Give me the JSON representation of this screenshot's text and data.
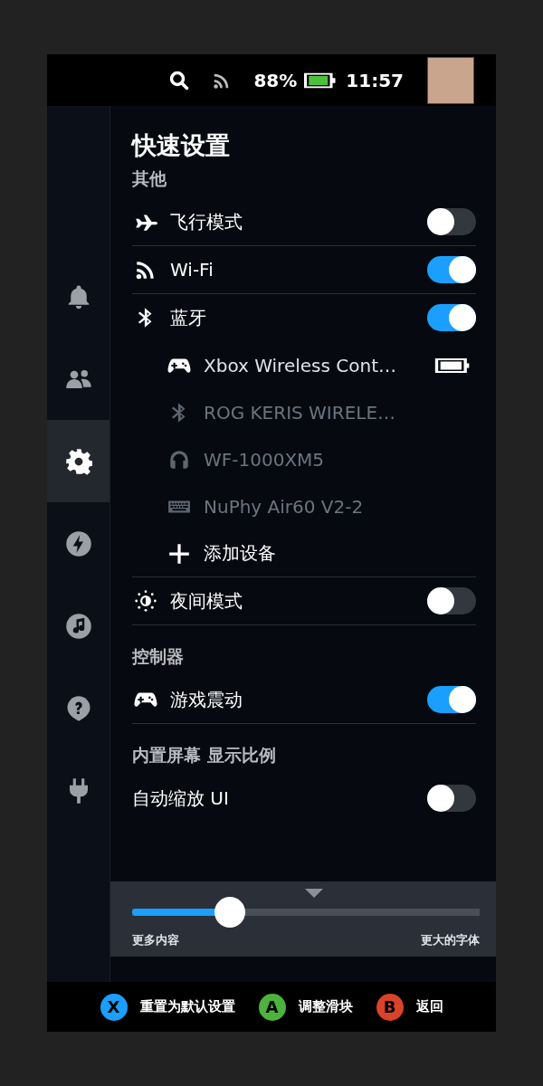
{
  "status_bar": {
    "battery_percent": "88%",
    "time": "11:57"
  },
  "sidebar": {
    "items": [
      {
        "kind": "notifications",
        "selected": false
      },
      {
        "kind": "friends",
        "selected": false
      },
      {
        "kind": "settings",
        "selected": true
      },
      {
        "kind": "performance",
        "selected": false
      },
      {
        "kind": "music",
        "selected": false
      },
      {
        "kind": "help",
        "selected": false
      },
      {
        "kind": "power",
        "selected": false
      }
    ]
  },
  "title": "快速设置",
  "sections": [
    {
      "heading": "其他",
      "rows": [
        {
          "kind": "toggle",
          "label": "飞行模式",
          "on": false
        },
        {
          "kind": "toggle",
          "label": "Wi-Fi",
          "on": true
        },
        {
          "kind": "toggle",
          "label": "蓝牙",
          "on": true
        },
        {
          "kind": "device",
          "label": "Xbox Wireless Cont…",
          "connected": true
        },
        {
          "kind": "device",
          "label": "ROG KERIS WIRELE…",
          "connected": false
        },
        {
          "kind": "device",
          "label": "WF-1000XM5",
          "connected": false
        },
        {
          "kind": "device",
          "label": "NuPhy Air60 V2-2",
          "connected": false
        },
        {
          "kind": "action",
          "label": "添加设备"
        },
        {
          "kind": "toggle",
          "label": "夜间模式",
          "on": false
        }
      ]
    },
    {
      "heading": "控制器",
      "rows": [
        {
          "kind": "toggle",
          "label": "游戏震动",
          "on": true
        }
      ]
    },
    {
      "heading": "内置屏幕 显示比例",
      "rows": [
        {
          "kind": "toggle",
          "label": "自动缩放 UI",
          "on": false
        }
      ]
    }
  ],
  "scale_slider": {
    "level": 0.28,
    "min_label": "更多内容",
    "max_label": "更大的字体"
  },
  "footer_hints": [
    {
      "button": "X",
      "label": "重置为默认设置",
      "color": "#1a9fff"
    },
    {
      "button": "A",
      "label": "调整滑块",
      "color": "#4cb43c"
    },
    {
      "button": "B",
      "label": "返回",
      "color": "#d9432a"
    }
  ]
}
